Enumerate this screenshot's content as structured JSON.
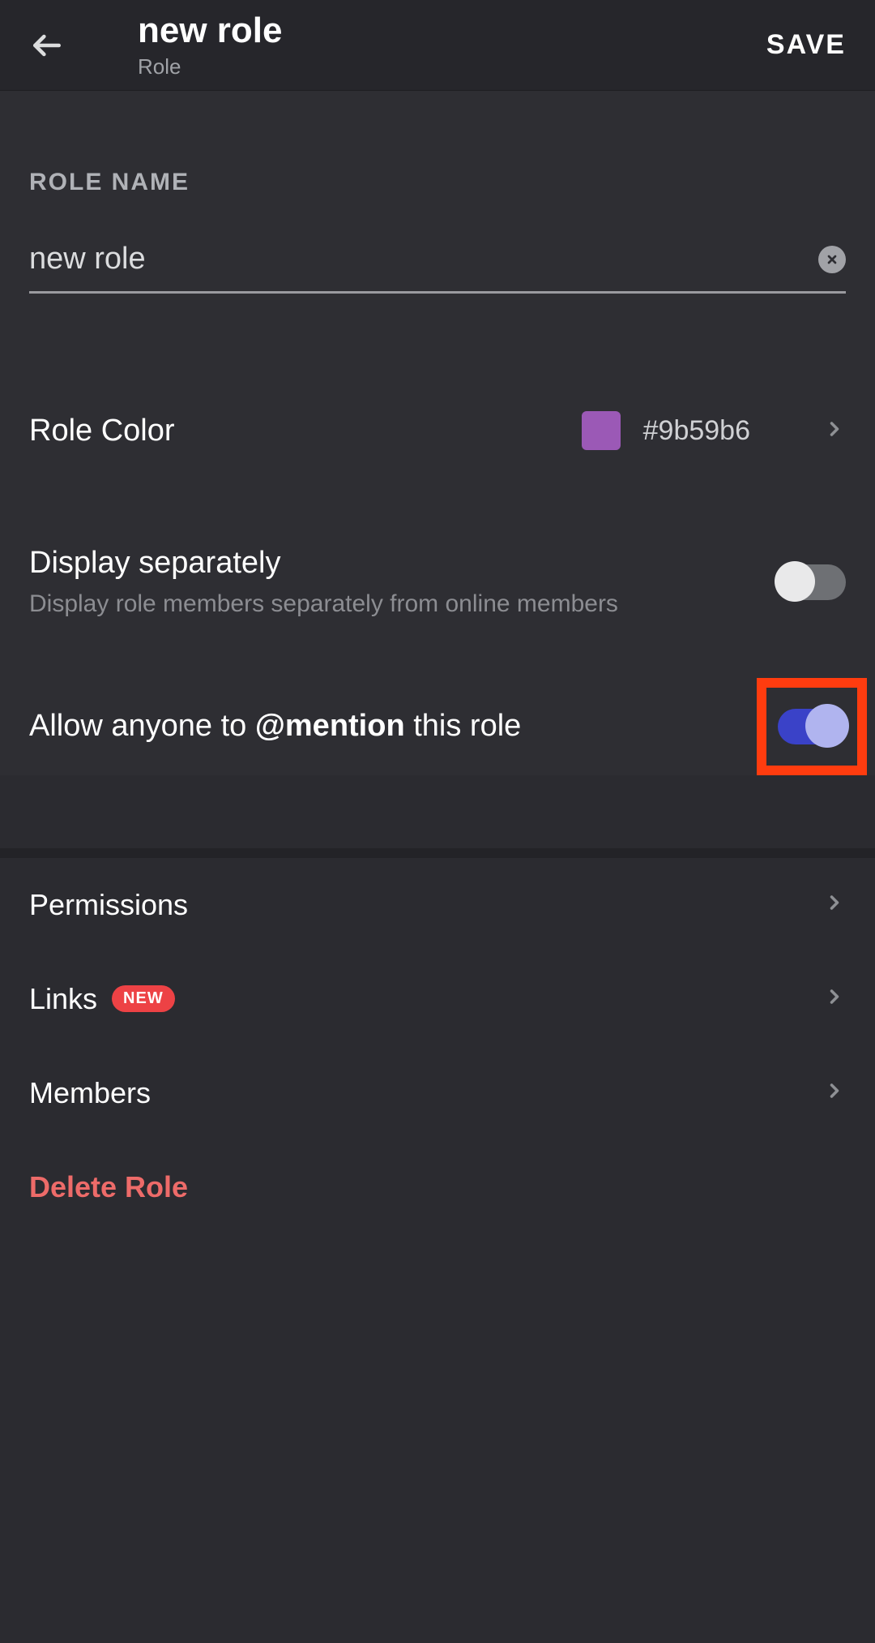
{
  "header": {
    "title": "new role",
    "subtitle": "Role",
    "save_label": "SAVE"
  },
  "role_name": {
    "label": "ROLE NAME",
    "value": "new role"
  },
  "role_color": {
    "label": "Role Color",
    "value": "#9b59b6",
    "swatch": "#9b59b6"
  },
  "display_separately": {
    "title": "Display separately",
    "subtitle": "Display role members separately from online members",
    "enabled": false
  },
  "allow_mention": {
    "prefix": "Allow anyone to ",
    "strong": "@mention",
    "suffix": " this role",
    "enabled": true
  },
  "nav": {
    "permissions": "Permissions",
    "links": "Links",
    "links_badge": "NEW",
    "members": "Members"
  },
  "delete_label": "Delete Role"
}
